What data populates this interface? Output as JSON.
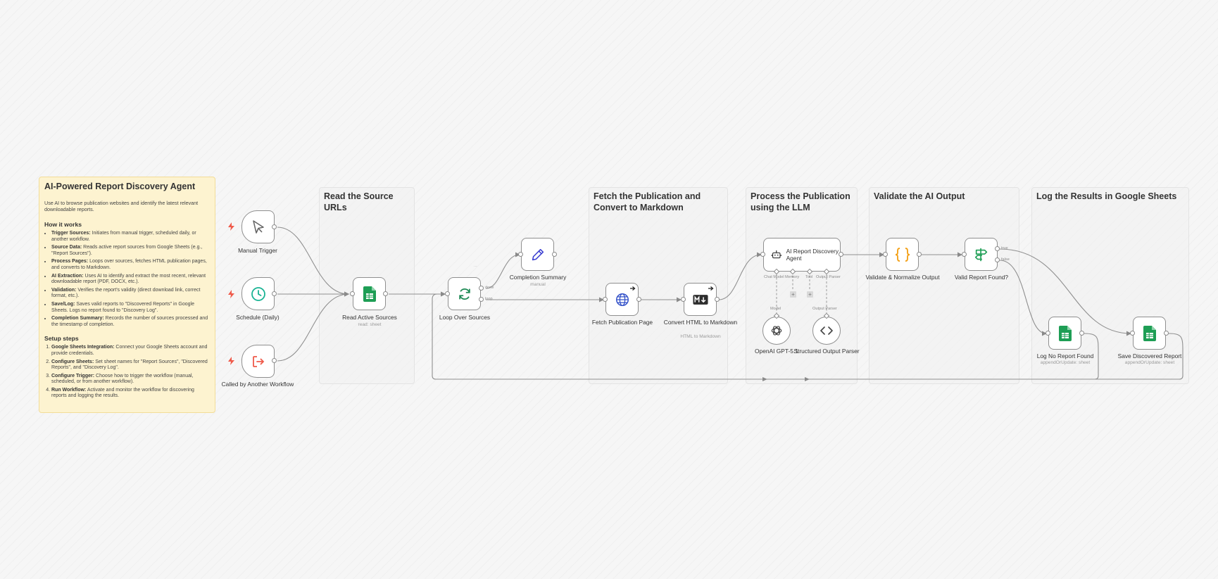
{
  "sticky_note": {
    "title": "AI-Powered Report Discovery Agent",
    "intro": "Use AI to browse publication websites and identify the latest relevant downloadable reports.",
    "how_heading": "How it works",
    "how_items": [
      {
        "term": "Trigger Sources:",
        "text": " Initiates from manual trigger, scheduled daily, or another workflow."
      },
      {
        "term": "Source Data:",
        "text": " Reads active report sources from Google Sheets (e.g., \"Report Sources\")."
      },
      {
        "term": "Process Pages:",
        "text": " Loops over sources, fetches HTML publication pages, and converts to Markdown."
      },
      {
        "term": "AI Extraction:",
        "text": " Uses AI to identify and extract the most recent, relevant downloadable report (PDF, DOCX, etc.)."
      },
      {
        "term": "Validation:",
        "text": " Verifies the report's validity (direct download link, correct format, etc.)."
      },
      {
        "term": "Save/Log:",
        "text": " Saves valid reports to \"Discovered Reports\" in Google Sheets. Logs no report found to \"Discovery Log\"."
      },
      {
        "term": "Completion Summary:",
        "text": " Records the number of sources processed and the timestamp of completion."
      }
    ],
    "setup_heading": "Setup steps",
    "setup_items": [
      {
        "term": "Google Sheets Integration:",
        "text": " Connect your Google Sheets account and provide credentials."
      },
      {
        "term": "Configure Sheets:",
        "text": " Set sheet names for \"Report Sources\", \"Discovered Reports\", and \"Discovery Log\"."
      },
      {
        "term": "Configure Trigger:",
        "text": " Choose how to trigger the workflow (manual, scheduled, or from another workflow)."
      },
      {
        "term": "Run Workflow:",
        "text": " Activate and monitor the workflow for discovering reports and logging the results."
      }
    ]
  },
  "sections": {
    "read_sources": "Read the Source URLs",
    "fetch_convert": "Fetch the Publication and Convert to Markdown",
    "process_llm": "Process the Publication using the LLM",
    "validate": "Validate the AI Output",
    "log_results": "Log the Results in Google Sheets"
  },
  "nodes": {
    "manual_trigger": {
      "label": "Manual Trigger"
    },
    "schedule": {
      "label": "Schedule (Daily)"
    },
    "called_by_workflow": {
      "label": "Called by Another Workflow"
    },
    "read_sources": {
      "label": "Read Active Sources",
      "sub": "read: sheet"
    },
    "loop": {
      "label": "Loop Over Sources",
      "out_done": "done",
      "out_loop": "loop"
    },
    "completion": {
      "label": "Completion Summary",
      "sub": "manual"
    },
    "fetch_page": {
      "label": "Fetch Publication Page"
    },
    "convert_md": {
      "label": "Convert HTML to Markdown",
      "sub": "HTML to Markdown"
    },
    "agent": {
      "label": "AI Report Discovery Agent",
      "port_chat_model": "Chat Model",
      "port_memory": "Memory",
      "port_tool": "Tool",
      "port_output_parser": "Output Parser"
    },
    "openai": {
      "label": "OpenAI GPT-5.1",
      "port": "Model"
    },
    "parser": {
      "label": "Structured Output Parser",
      "port": "Output Parser"
    },
    "validate": {
      "label": "Validate & Normalize Output"
    },
    "valid_if": {
      "label": "Valid Report Found?",
      "out_true": "true",
      "out_false": "false"
    },
    "log_no_report": {
      "label": "Log No Report Found",
      "sub": "appendOrUpdate: sheet"
    },
    "save_report": {
      "label": "Save Discovered Report",
      "sub": "appendOrUpdate: sheet"
    }
  },
  "misc": {
    "ellipsis": "...",
    "plus": "+"
  },
  "colors": {
    "sheets_green": "#1e9e55",
    "schedule_teal": "#19b394",
    "trigger_red": "#ef5a4a",
    "globe_blue": "#3250c8",
    "code_orange": "#f3a21b",
    "note_bg": "#fdf3d0"
  }
}
